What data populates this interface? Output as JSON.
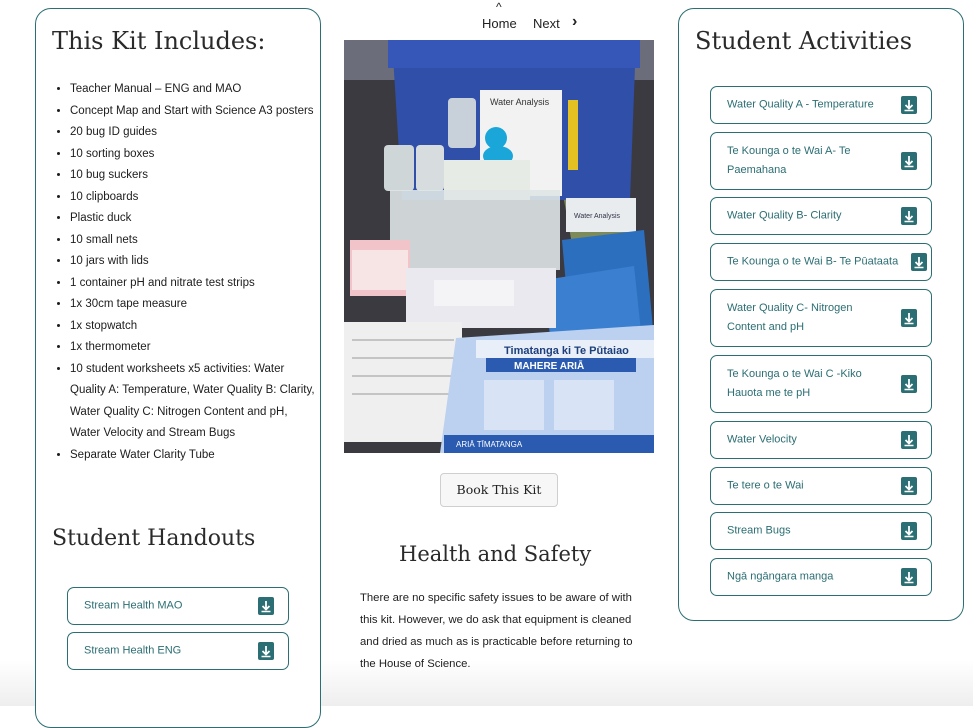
{
  "nav": {
    "up_arrow": "^",
    "home": "Home",
    "next": "Next",
    "next_chevron": "›"
  },
  "kit": {
    "title": "This Kit Includes:",
    "items": [
      "Teacher Manual – ENG and MAO",
      "Concept Map and Start with Science A3 posters",
      "20 bug ID guides",
      "10 sorting boxes",
      "10 bug suckers",
      "10 clipboards",
      "Plastic duck",
      "10 small nets",
      "10 jars with lids",
      "1 container pH and nitrate test strips",
      "1x 30cm tape measure",
      "1x stopwatch",
      "1x thermometer",
      "10 student worksheets x5 activities: Water Quality A: Temperature, Water Quality B: Clarity, Water Quality C: Nitrogen Content and pH, Water Velocity and Stream Bugs",
      "Separate Water Clarity Tube"
    ]
  },
  "handouts": {
    "title": "Student Handouts",
    "items": [
      "Stream Health MAO",
      "Stream Health ENG"
    ]
  },
  "photo": {
    "box_label": "Water Analysis",
    "clipboard_label": "Water Analysis",
    "poster_title": "Timatanga ki Te Pūtaiao",
    "poster_subtitle": "MAHERE ARIĀ",
    "poster_footer": "ARIĀ TĪMATANGA"
  },
  "book_button": "Book This Kit",
  "health": {
    "title": "Health and Safety",
    "text": "There are no specific safety issues to be aware of with this kit. However, we do ask that equipment is cleaned and dried as much as is practicable before returning to the House of Science."
  },
  "activities": {
    "title": "Student Activities",
    "items": [
      "Water Quality A - Temperature",
      "Te Kounga o te Wai A- Te Paemahana",
      "Water Quality B- Clarity",
      "Te Kounga o te Wai B- Te Pūataata",
      "Water Quality C- Nitrogen Content and pH",
      "Te Kounga o te Wai C -Kiko Hauota me te pH",
      "Water Velocity",
      "Te tere o te Wai",
      "Stream Bugs",
      "Ngā ngāngara manga"
    ]
  },
  "colors": {
    "accent": "#2b6e73",
    "text": "#1d1d1d"
  },
  "icons": {
    "download": "download-icon"
  }
}
